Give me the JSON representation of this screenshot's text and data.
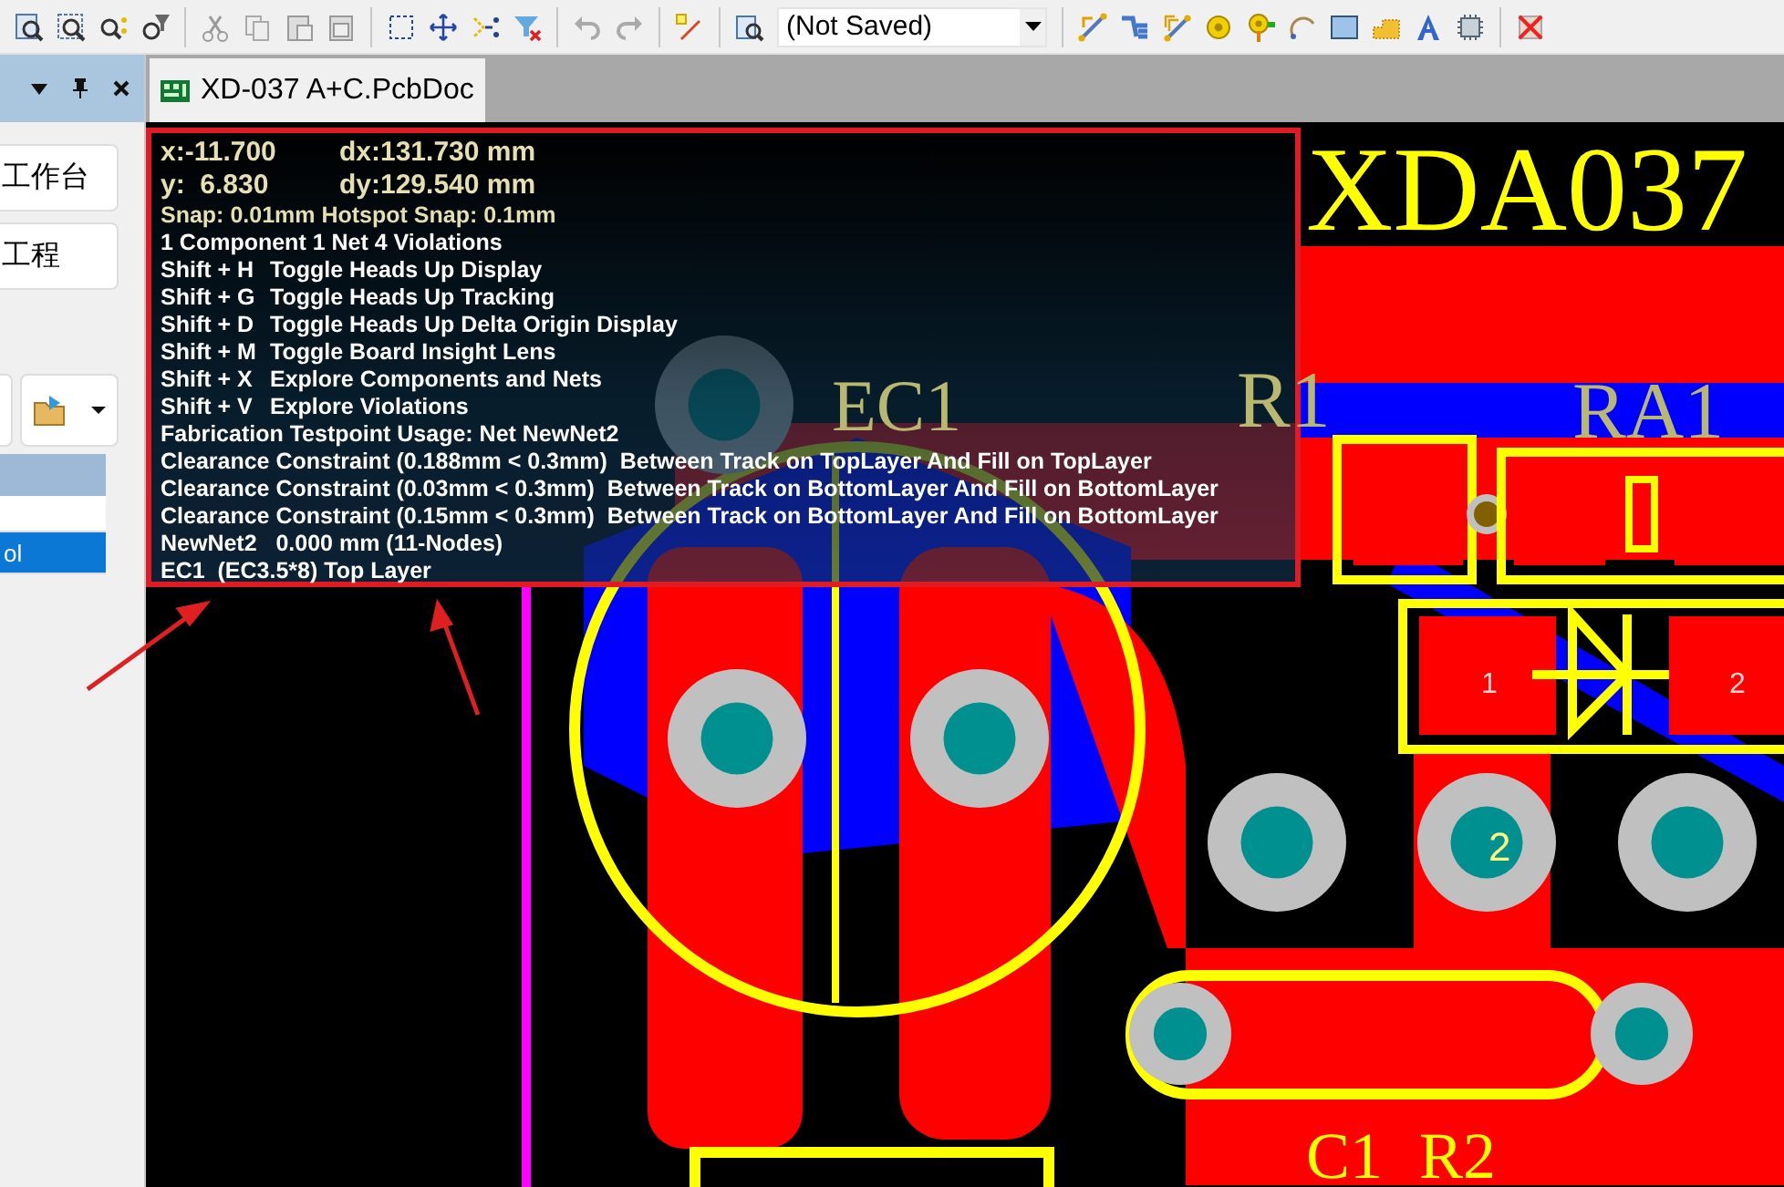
{
  "toolbar": {
    "view_dropdown": "(Not Saved)"
  },
  "panel": {
    "buttons": [
      "工作台",
      "工程"
    ],
    "table": {
      "rows": [
        {
          "selected": false
        },
        {
          "text": "ol",
          "selected": true
        }
      ]
    }
  },
  "tabs": [
    {
      "label": "XD-037 A+C.PcbDoc",
      "selected": true
    }
  ],
  "heads_up": {
    "lines": [
      {
        "kind": "coord",
        "text": "x:-11.700",
        "delta": "dx:131.730 mm"
      },
      {
        "kind": "coord",
        "text": "y:  6.830",
        "delta": "dy:129.540 mm"
      },
      {
        "kind": "snap",
        "text": "Snap: 0.01mm Hotspot Snap: 0.1mm"
      },
      {
        "kind": "info",
        "text": "1 Component 1 Net 4 Violations"
      },
      {
        "kind": "shortcut",
        "text": "Shift + H",
        "delta": "Toggle Heads Up Display"
      },
      {
        "kind": "shortcut",
        "text": "Shift + G",
        "delta": "Toggle Heads Up Tracking"
      },
      {
        "kind": "shortcut",
        "text": "Shift + D",
        "delta": "Toggle Heads Up Delta Origin Display"
      },
      {
        "kind": "shortcut",
        "text": "Shift + M",
        "delta": "Toggle Board Insight Lens"
      },
      {
        "kind": "shortcut",
        "text": "Shift + X",
        "delta": "Explore Components and Nets"
      },
      {
        "kind": "shortcut",
        "text": "Shift + V",
        "delta": "Explore Violations"
      },
      {
        "kind": "info",
        "text": "Fabrication Testpoint Usage: Net NewNet2"
      },
      {
        "kind": "info",
        "text": "Clearance Constraint (0.188mm < 0.3mm)  Between Track on TopLayer And Fill on TopLayer"
      },
      {
        "kind": "info",
        "text": "Clearance Constraint (0.03mm < 0.3mm)  Between Track on BottomLayer And Fill on BottomLayer"
      },
      {
        "kind": "info",
        "text": "Clearance Constraint (0.15mm < 0.3mm)  Between Track on BottomLayer And Fill on BottomLayer"
      },
      {
        "kind": "info",
        "text": "NewNet2   0.000 mm (11-Nodes)"
      },
      {
        "kind": "info",
        "text": "EC1  (EC3.5*8) Top Layer"
      }
    ]
  },
  "board_labels": [
    {
      "kind": "overlay",
      "text": "XDA037"
    },
    {
      "kind": "silkscreen",
      "text": "EC1"
    },
    {
      "kind": "silkscreen",
      "text": "R1"
    },
    {
      "kind": "silkscreen",
      "text": "RA1"
    },
    {
      "kind": "pad",
      "text": "1"
    },
    {
      "kind": "pad",
      "text": "2"
    },
    {
      "kind": "pad",
      "text": "2"
    },
    {
      "kind": "overlay",
      "text": "C1"
    },
    {
      "kind": "overlay",
      "text": "R2"
    }
  ]
}
